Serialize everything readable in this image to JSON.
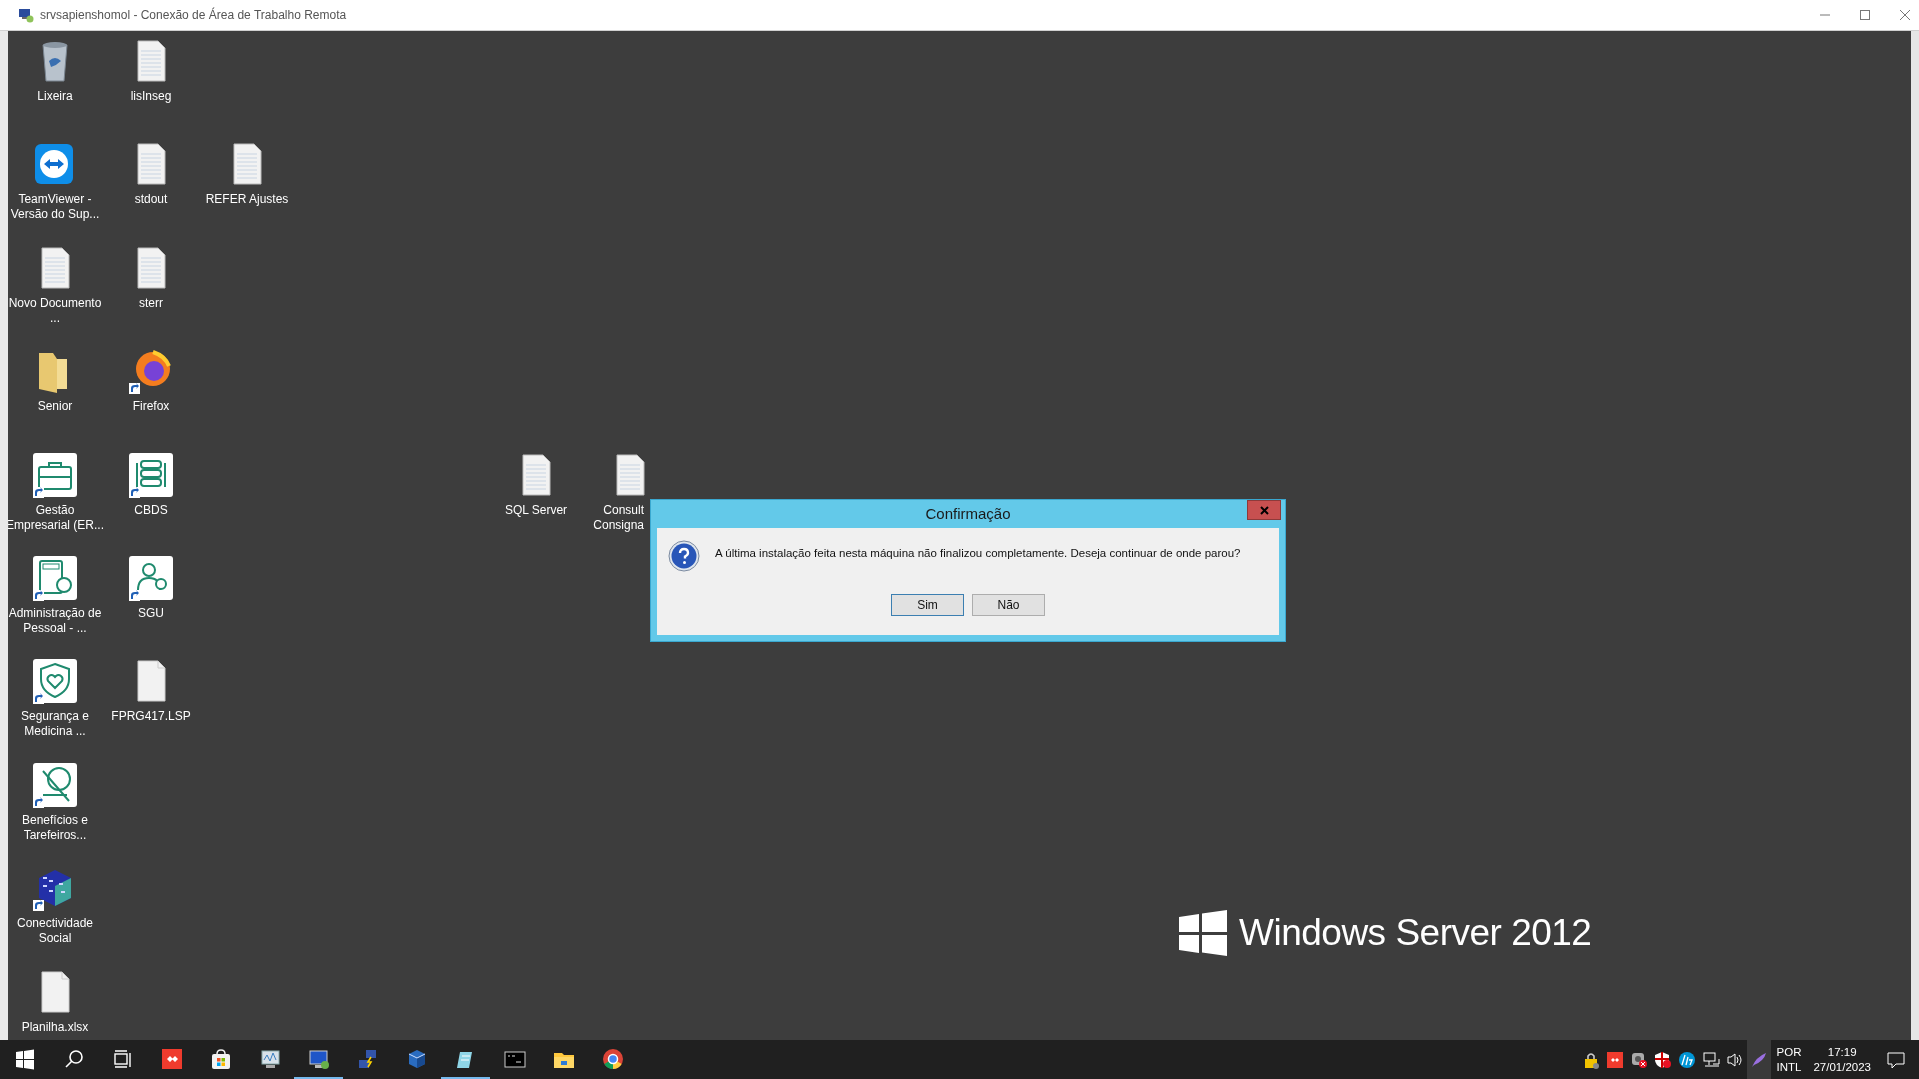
{
  "window": {
    "title": "srvsapienshomol - Conexão de Área de Trabalho Remota"
  },
  "desktop": {
    "icons": [
      {
        "label": "Lixeira",
        "kind": "recycle_bin",
        "shortcut": false
      },
      {
        "label": "lisInseg",
        "kind": "document",
        "shortcut": false
      },
      {
        "label": "TeamViewer - Versão do Sup...",
        "kind": "remote_app",
        "shortcut": false
      },
      {
        "label": "stdout",
        "kind": "document",
        "shortcut": false
      },
      {
        "label": "REFER Ajustes",
        "kind": "document",
        "shortcut": false
      },
      {
        "label": "Novo Documento ...",
        "kind": "document",
        "shortcut": false
      },
      {
        "label": "sterr",
        "kind": "document",
        "shortcut": false
      },
      {
        "label": "Senior",
        "kind": "folder",
        "shortcut": false
      },
      {
        "label": "Firefox",
        "kind": "browser",
        "shortcut": true
      },
      {
        "label": "Gestão Empresarial (ER...",
        "kind": "app",
        "shortcut": true
      },
      {
        "label": "CBDS",
        "kind": "app",
        "shortcut": true
      },
      {
        "label": "SQL Server",
        "kind": "document",
        "shortcut": false
      },
      {
        "label": "Consult Consigna",
        "kind": "document",
        "shortcut": false
      },
      {
        "label": "Administração de Pessoal - ...",
        "kind": "app",
        "shortcut": true
      },
      {
        "label": "SGU",
        "kind": "app",
        "shortcut": true
      },
      {
        "label": "Segurança e Medicina ...",
        "kind": "app",
        "shortcut": true
      },
      {
        "label": "FPRG417.LSP",
        "kind": "blank_file",
        "shortcut": false
      },
      {
        "label": "Benefícios e Tarefeiros...",
        "kind": "app",
        "shortcut": true
      },
      {
        "label": "Conectividade Social",
        "kind": "cube",
        "shortcut": true
      },
      {
        "label": "Planilha.xlsx",
        "kind": "blank_file",
        "shortcut": false
      }
    ],
    "wallpaper_text": "Windows Server 2012"
  },
  "dialog": {
    "title": "Confirmação",
    "message": "A última instalação feita nesta máquina não finalizou completamente. Deseja continuar de onde parou?",
    "buttons": [
      {
        "label": "Sim",
        "selected": true
      },
      {
        "label": "Não",
        "selected": false
      }
    ]
  },
  "taskbar": {
    "items": [
      {
        "kind": "start",
        "running": false
      },
      {
        "kind": "search",
        "running": false
      },
      {
        "kind": "task_view",
        "running": false
      },
      {
        "kind": "remote_support",
        "running": false
      },
      {
        "kind": "store",
        "running": false
      },
      {
        "kind": "monitor",
        "running": false
      },
      {
        "kind": "remote_desktop",
        "running": true
      },
      {
        "kind": "network",
        "running": false
      },
      {
        "kind": "cube",
        "running": false
      },
      {
        "kind": "notepad",
        "running": true
      },
      {
        "kind": "terminal",
        "running": false
      },
      {
        "kind": "folder",
        "running": false
      },
      {
        "kind": "browser",
        "running": false
      }
    ],
    "tray": [
      {
        "kind": "padlock"
      },
      {
        "kind": "remote_support"
      },
      {
        "kind": "gear_error"
      },
      {
        "kind": "shield_error"
      },
      {
        "kind": "printer_brand"
      },
      {
        "kind": "network"
      },
      {
        "kind": "speaker"
      },
      {
        "kind": "feather"
      }
    ],
    "language": [
      "POR",
      "INTL"
    ],
    "time": "17:19",
    "date": "27/01/2023"
  }
}
